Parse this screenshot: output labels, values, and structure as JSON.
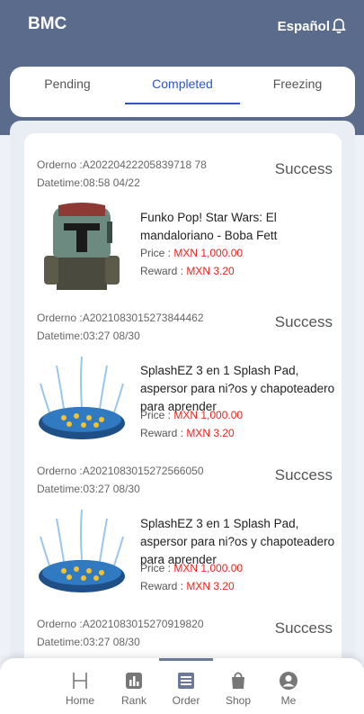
{
  "header": {
    "brand": "BMC",
    "language": "Español"
  },
  "tabs": [
    {
      "label": "Pending"
    },
    {
      "label": "Completed"
    },
    {
      "label": "Freezing"
    }
  ],
  "orders": [
    {
      "order_no": "Orderno :A20220422205839718 78",
      "datetime": "Datetime:08:58 04/22",
      "status": "Success",
      "product": "Funko Pop! Star Wars: El mandaloriano - Boba Fett",
      "price_label": "Price :",
      "price": "MXN 1,000.00",
      "reward_label": "Reward :",
      "reward": "MXN 3.20"
    },
    {
      "order_no": "Orderno :A2021083015273844462",
      "datetime": "Datetime:03:27 08/30",
      "status": "Success",
      "product": "SplashEZ 3 en 1 Splash Pad, aspersor para ni?os y chapoteadero para aprender",
      "price_label": "Price :",
      "price": "MXN 1,000.00",
      "reward_label": "Reward :",
      "reward": "MXN 3.20"
    },
    {
      "order_no": "Orderno :A2021083015272566050",
      "datetime": "Datetime:03:27 08/30",
      "status": "Success",
      "product": "SplashEZ 3 en 1 Splash Pad, aspersor para ni?os y chapoteadero para aprender",
      "price_label": "Price :",
      "price": "MXN 1,000.00",
      "reward_label": "Reward :",
      "reward": "MXN 3.20"
    },
    {
      "order_no": "Orderno :A2021083015270919820",
      "datetime": "Datetime:03:27 08/30",
      "status": "Success"
    }
  ],
  "nav": [
    {
      "label": "Home",
      "icon": "home-icon"
    },
    {
      "label": "Rank",
      "icon": "rank-icon"
    },
    {
      "label": "Order",
      "icon": "order-icon"
    },
    {
      "label": "Shop",
      "icon": "shop-icon"
    },
    {
      "label": "Me",
      "icon": "me-icon"
    }
  ],
  "colors": {
    "header": "#5a6b8c",
    "accent": "#2d55c8",
    "price": "#e6261f"
  }
}
